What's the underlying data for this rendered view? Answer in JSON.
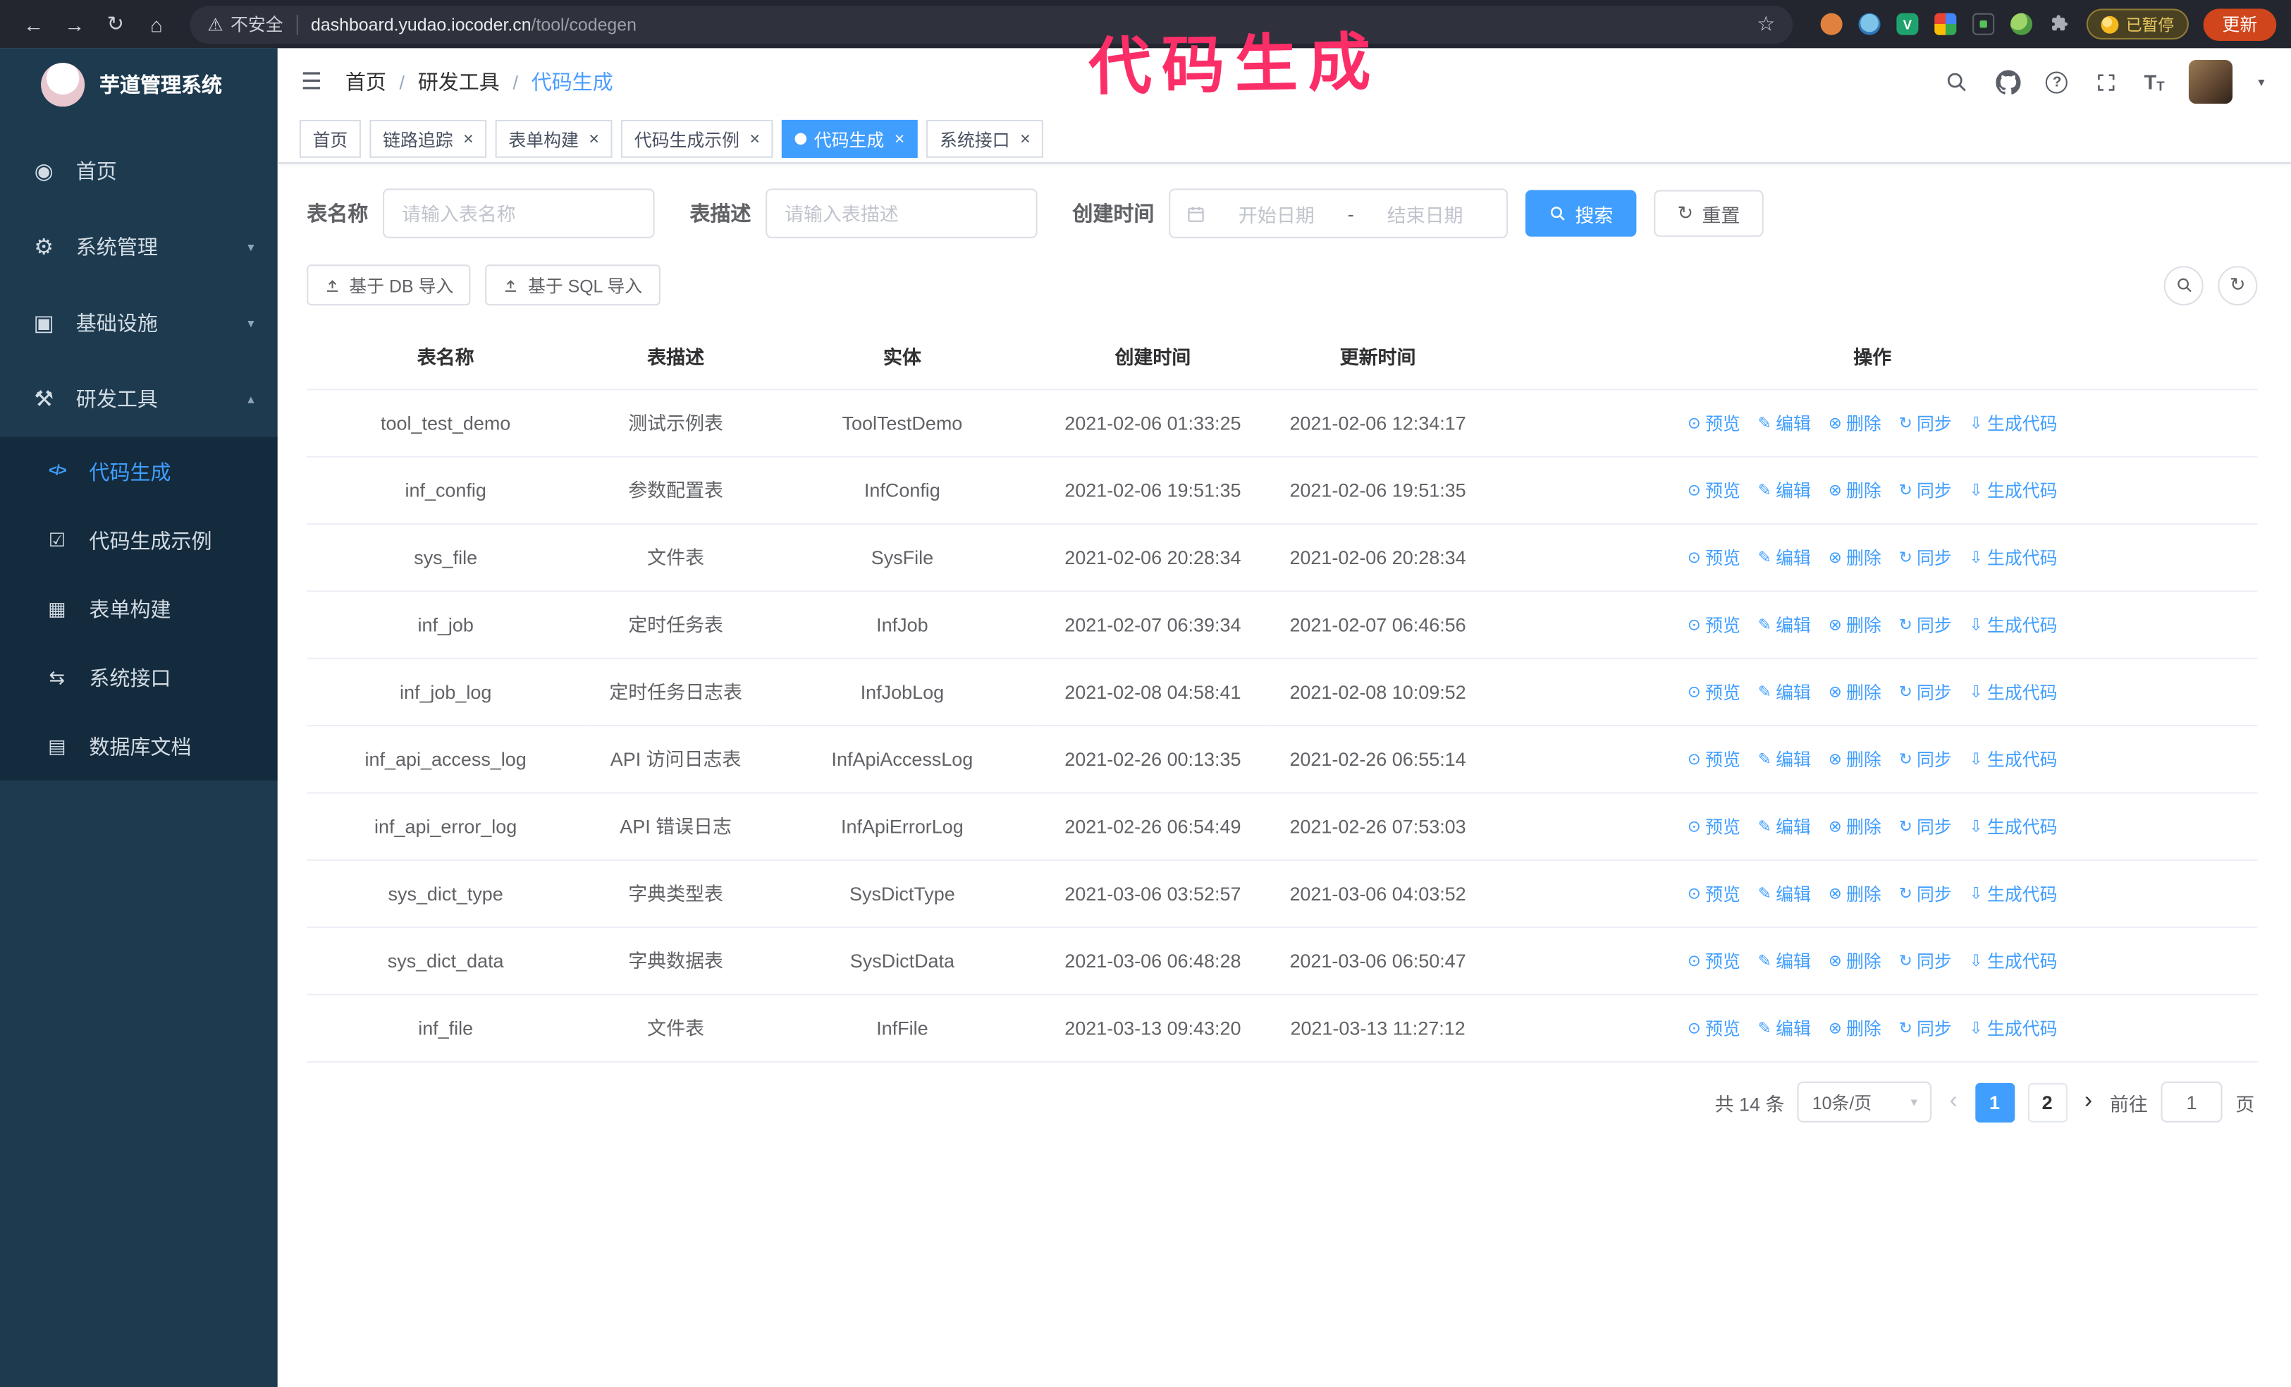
{
  "browser": {
    "security_label": "不安全",
    "url_domain": "dashboard.yudao.iocoder.cn",
    "url_path": "/tool/codegen",
    "paused_badge": "已暂停",
    "update_button": "更新"
  },
  "annotation": {
    "text": "代码生成"
  },
  "colors": {
    "accent": "#409eff",
    "annotation_pink": "#fb2e68",
    "sidebar_bg": "#1d3a4f"
  },
  "sidebar": {
    "logo_title": "芋道管理系统",
    "items": [
      {
        "label": "首页"
      },
      {
        "label": "系统管理"
      },
      {
        "label": "基础设施"
      },
      {
        "label": "研发工具"
      }
    ],
    "submenu": [
      {
        "label": "代码生成"
      },
      {
        "label": "代码生成示例"
      },
      {
        "label": "表单构建"
      },
      {
        "label": "系统接口"
      },
      {
        "label": "数据库文档"
      }
    ]
  },
  "header": {
    "breadcrumb": [
      "首页",
      "研发工具",
      "代码生成"
    ]
  },
  "tabs": [
    {
      "label": "首页",
      "closable": false,
      "active": false
    },
    {
      "label": "链路追踪",
      "closable": true,
      "active": false
    },
    {
      "label": "表单构建",
      "closable": true,
      "active": false
    },
    {
      "label": "代码生成示例",
      "closable": true,
      "active": false
    },
    {
      "label": "代码生成",
      "closable": true,
      "active": true
    },
    {
      "label": "系统接口",
      "closable": true,
      "active": false
    }
  ],
  "filters": {
    "table_name_label": "表名称",
    "table_name_placeholder": "请输入表名称",
    "table_desc_label": "表描述",
    "table_desc_placeholder": "请输入表描述",
    "create_time_label": "创建时间",
    "date_start_placeholder": "开始日期",
    "date_separator": "-",
    "date_end_placeholder": "结束日期",
    "search_button": "搜索",
    "reset_button": "重置"
  },
  "toolbar": {
    "import_db": "基于 DB 导入",
    "import_sql": "基于 SQL 导入"
  },
  "table": {
    "columns": [
      "表名称",
      "表描述",
      "实体",
      "创建时间",
      "更新时间",
      "操作"
    ],
    "row_actions": [
      "预览",
      "编辑",
      "删除",
      "同步",
      "生成代码"
    ],
    "rows": [
      {
        "name": "tool_test_demo",
        "desc": "测试示例表",
        "entity": "ToolTestDemo",
        "create_time": "2021-02-06 01:33:25",
        "update_time": "2021-02-06 12:34:17"
      },
      {
        "name": "inf_config",
        "desc": "参数配置表",
        "entity": "InfConfig",
        "create_time": "2021-02-06 19:51:35",
        "update_time": "2021-02-06 19:51:35"
      },
      {
        "name": "sys_file",
        "desc": "文件表",
        "entity": "SysFile",
        "create_time": "2021-02-06 20:28:34",
        "update_time": "2021-02-06 20:28:34"
      },
      {
        "name": "inf_job",
        "desc": "定时任务表",
        "entity": "InfJob",
        "create_time": "2021-02-07 06:39:34",
        "update_time": "2021-02-07 06:46:56"
      },
      {
        "name": "inf_job_log",
        "desc": "定时任务日志表",
        "entity": "InfJobLog",
        "create_time": "2021-02-08 04:58:41",
        "update_time": "2021-02-08 10:09:52"
      },
      {
        "name": "inf_api_access_log",
        "desc": "API 访问日志表",
        "entity": "InfApiAccessLog",
        "create_time": "2021-02-26 00:13:35",
        "update_time": "2021-02-26 06:55:14"
      },
      {
        "name": "inf_api_error_log",
        "desc": "API 错误日志",
        "entity": "InfApiErrorLog",
        "create_time": "2021-02-26 06:54:49",
        "update_time": "2021-02-26 07:53:03"
      },
      {
        "name": "sys_dict_type",
        "desc": "字典类型表",
        "entity": "SysDictType",
        "create_time": "2021-03-06 03:52:57",
        "update_time": "2021-03-06 04:03:52"
      },
      {
        "name": "sys_dict_data",
        "desc": "字典数据表",
        "entity": "SysDictData",
        "create_time": "2021-03-06 06:48:28",
        "update_time": "2021-03-06 06:50:47"
      },
      {
        "name": "inf_file",
        "desc": "文件表",
        "entity": "InfFile",
        "create_time": "2021-03-13 09:43:20",
        "update_time": "2021-03-13 11:27:12"
      }
    ]
  },
  "pagination": {
    "total": "共 14 条",
    "page_size": "10条/页",
    "pages": [
      "1",
      "2"
    ],
    "goto_label": "前往",
    "goto_value": "1",
    "goto_suffix": "页"
  }
}
